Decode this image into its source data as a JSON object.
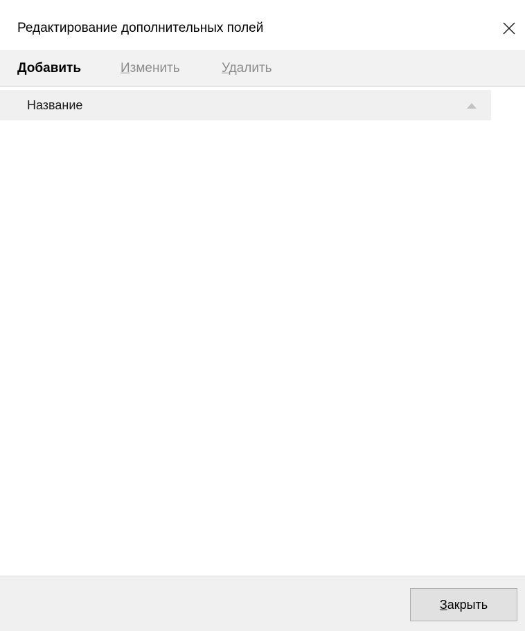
{
  "window": {
    "title": "Редактирование дополнительных полей"
  },
  "toolbar": {
    "add": {
      "mnemonic": "Д",
      "rest": "обавить"
    },
    "edit": {
      "mnemonic": "И",
      "rest": "зменить"
    },
    "delete": {
      "mnemonic": "У",
      "rest": "далить"
    }
  },
  "list": {
    "columns": [
      {
        "label": "Название",
        "sort": "ascending"
      }
    ],
    "rows": []
  },
  "footer": {
    "close": {
      "mnemonic": "З",
      "rest": "акрыть"
    }
  },
  "icons": {
    "close": "close-icon",
    "sort": "sort-ascending-icon"
  },
  "colors": {
    "toolbar_bg": "#f2f2f2",
    "disabled_text": "#8d8d8d",
    "header_bg": "#f0f0f0",
    "footer_bg": "#f0f0f0",
    "button_bg": "#e1e1e1"
  }
}
